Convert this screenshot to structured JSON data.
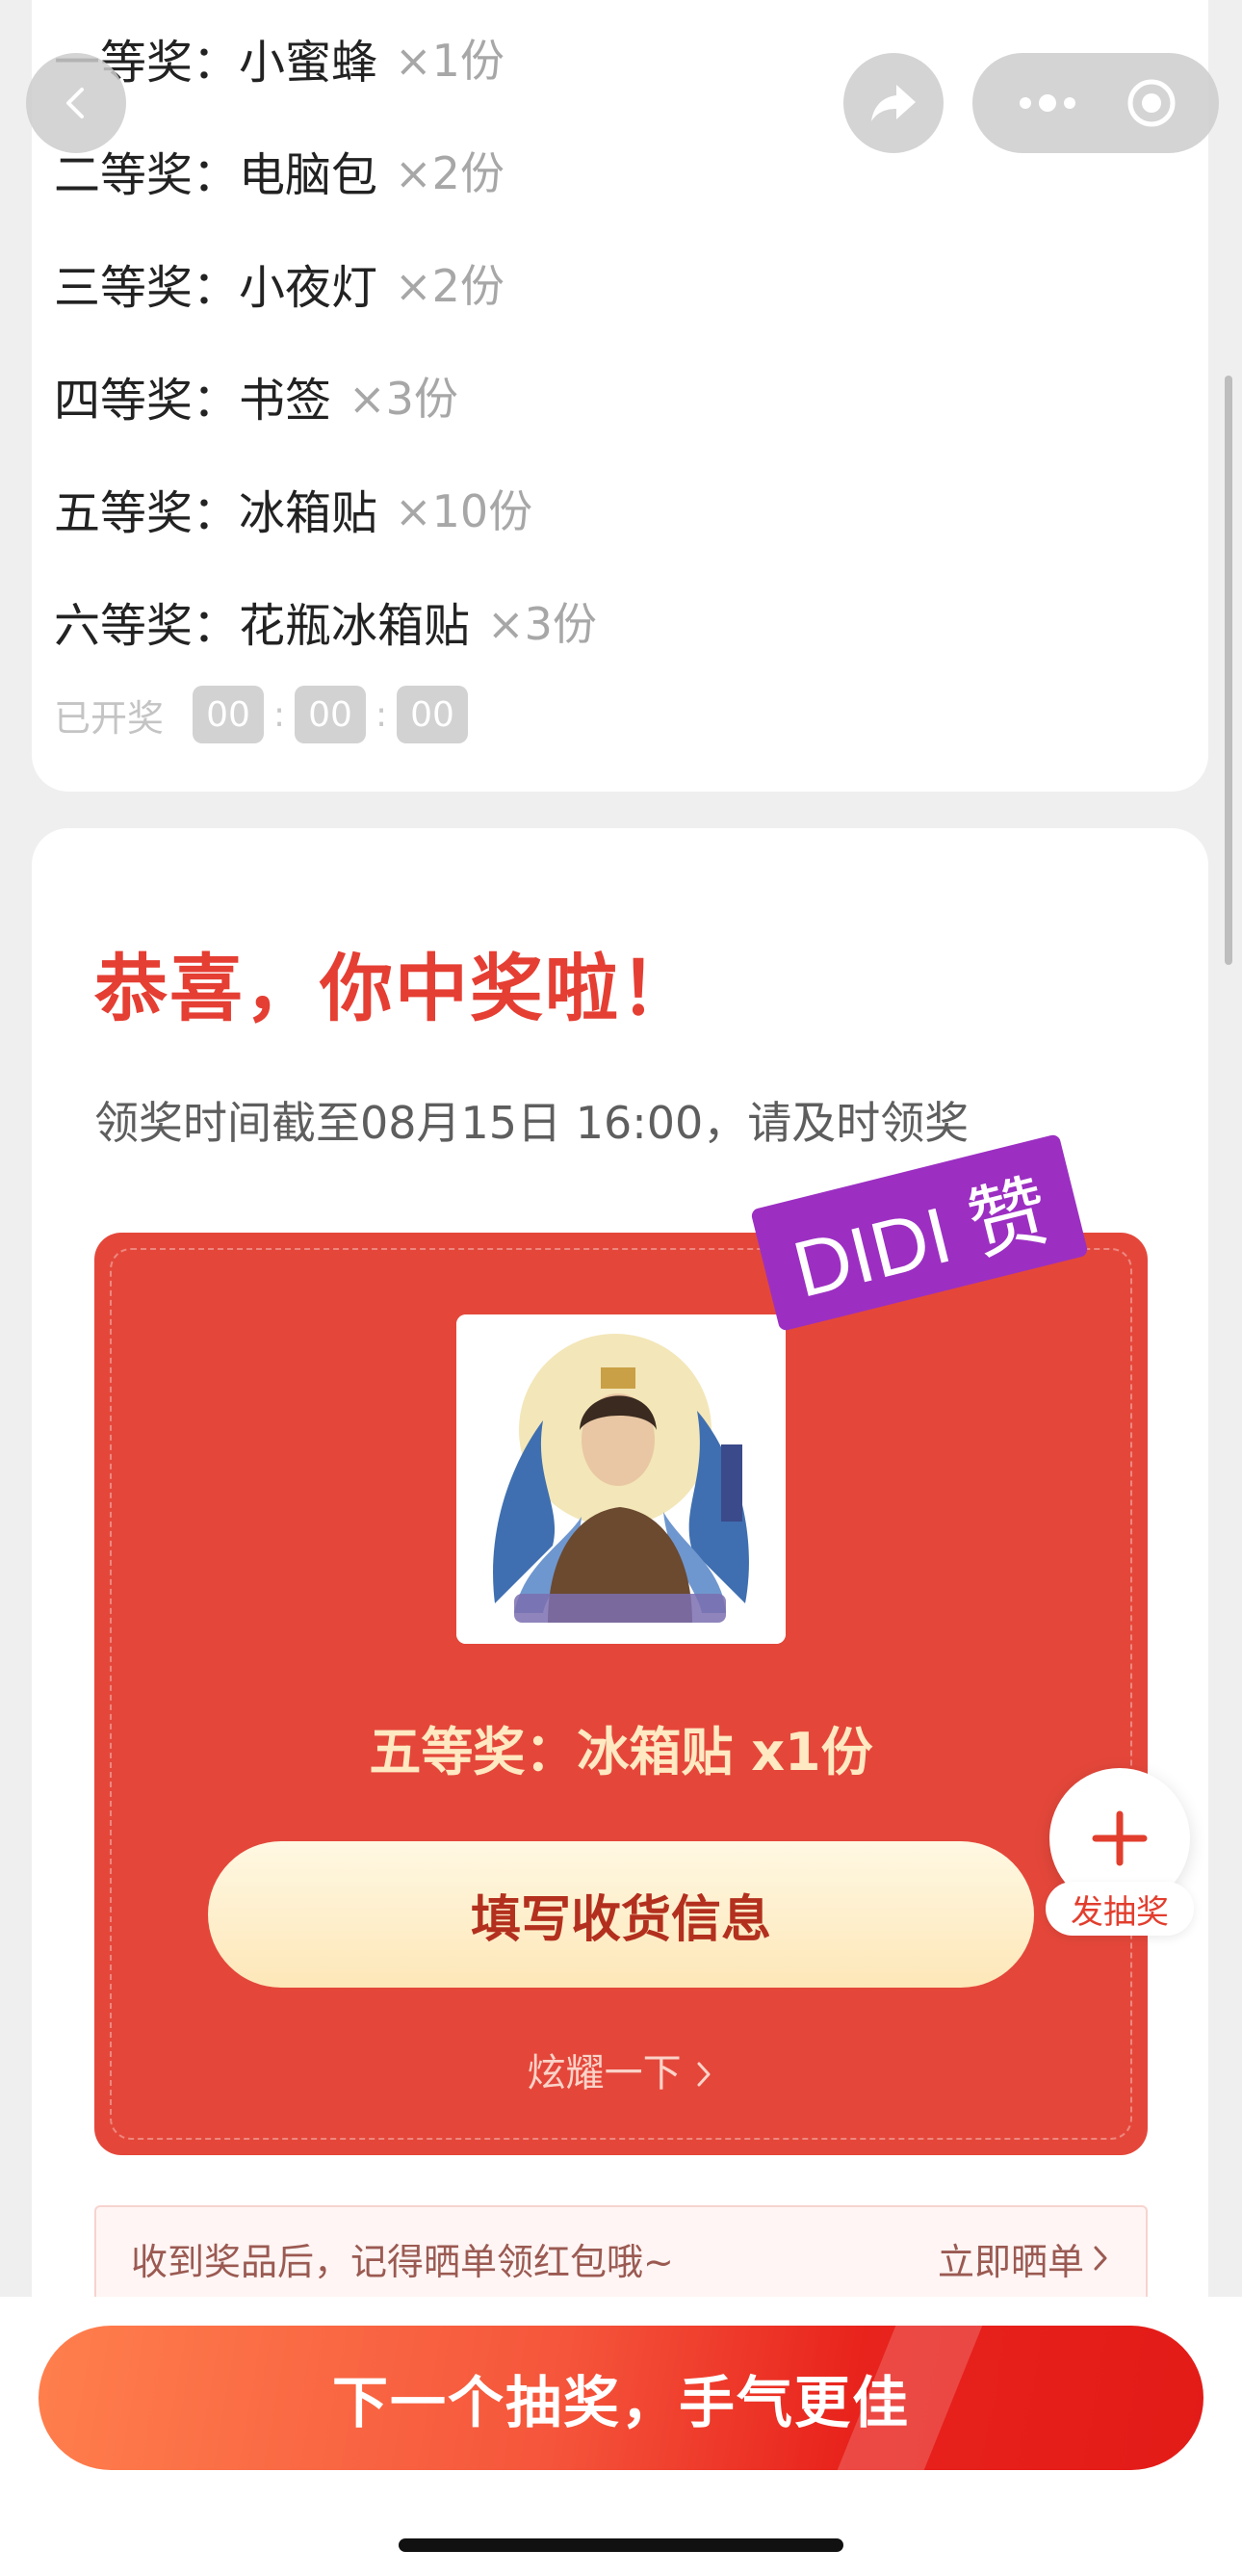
{
  "prizes": [
    {
      "tier": "一等奖：",
      "name": "小蜜蜂",
      "qty": "×1份"
    },
    {
      "tier": "二等奖：",
      "name": "电脑包",
      "qty": "×2份"
    },
    {
      "tier": "三等奖：",
      "name": "小夜灯",
      "qty": "×2份"
    },
    {
      "tier": "四等奖：",
      "name": "书签",
      "qty": "×3份"
    },
    {
      "tier": "五等奖：",
      "name": "冰箱贴",
      "qty": "×10份"
    },
    {
      "tier": "六等奖：",
      "name": "花瓶冰箱贴",
      "qty": "×3份"
    }
  ],
  "countdown": {
    "label": "已开奖",
    "hours": "00",
    "minutes": "00",
    "seconds": "00",
    "separator": ":"
  },
  "result": {
    "title": "恭喜，你中奖啦！",
    "deadline": "领奖时间截至08月15日 16:00，请及时领奖",
    "won_prize": "五等奖：冰箱贴 x1份",
    "fill_button": "填写收货信息",
    "show_off": "炫耀一下",
    "sticker": "DIDI 赞"
  },
  "fab": {
    "label": "发抽奖"
  },
  "share_banner": {
    "message": "收到奖品后，记得晒单领红包哦~",
    "action": "立即晒单"
  },
  "bottom": {
    "next_button": "下一个抽奖，手气更佳"
  },
  "colors": {
    "accent_red": "#e4473a",
    "title_red": "#e53e33",
    "sticker_purple": "#9c2fc2"
  },
  "icons": [
    "back-icon",
    "share-icon",
    "more-icon",
    "close-target-icon",
    "plus-icon",
    "chevron-right-icon"
  ]
}
